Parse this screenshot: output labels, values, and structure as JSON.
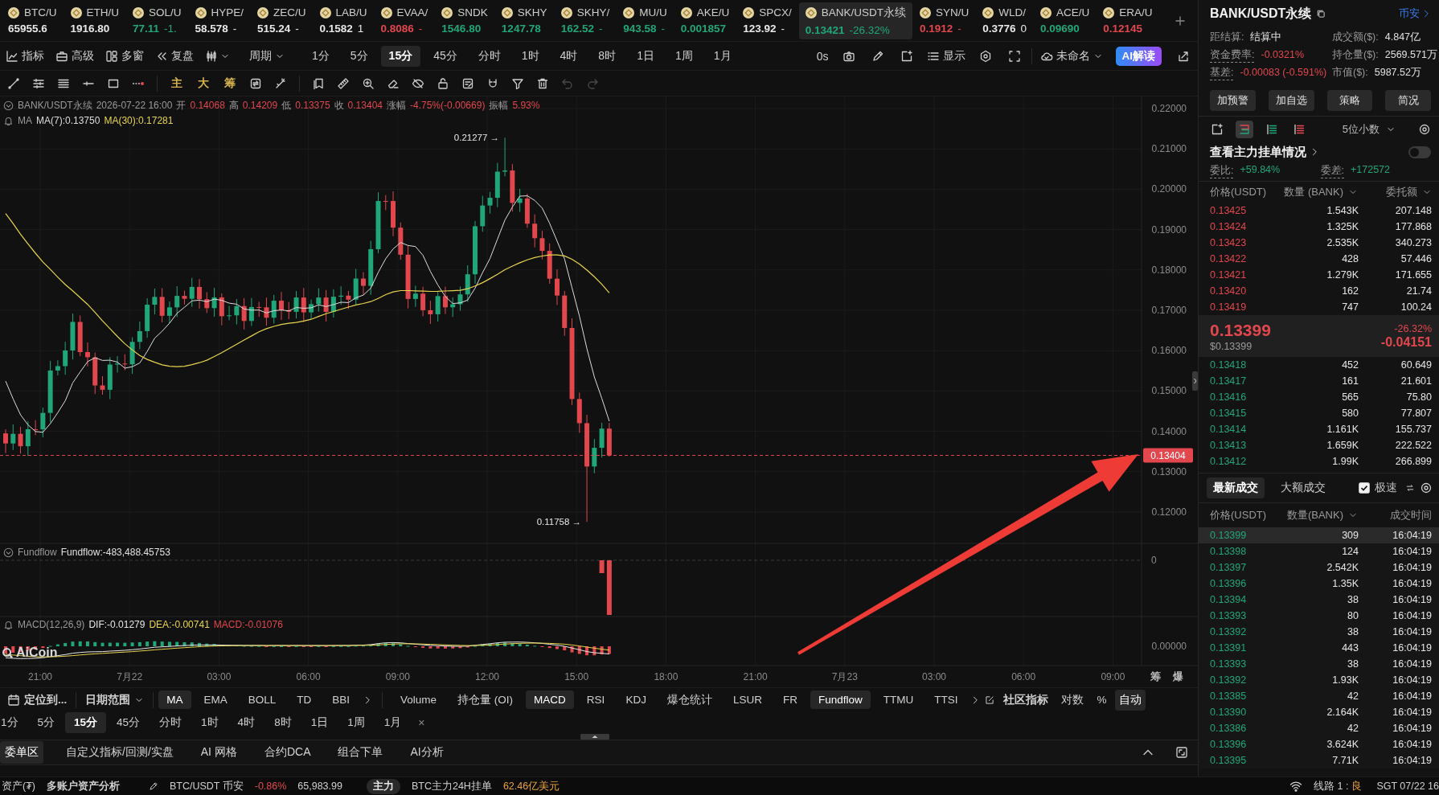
{
  "ticker": {
    "items": [
      {
        "symbol": "BTC/U",
        "price": "65955.6",
        "color": "#e8e8e8",
        "selected": false
      },
      {
        "symbol": "ETH/U",
        "price": "1916.80",
        "color": "#e8e8e8",
        "selected": false
      },
      {
        "symbol": "SOL/U",
        "price": "77.11",
        "change": "-1.",
        "color": "#21a67a",
        "selected": false
      },
      {
        "symbol": "HYPE/",
        "price": "58.578",
        "change": "-",
        "color": "#e8e8e8",
        "selected": false
      },
      {
        "symbol": "ZEC/U",
        "price": "515.24",
        "change": "-",
        "color": "#e8e8e8",
        "selected": false
      },
      {
        "symbol": "LAB/U",
        "price": "0.1582",
        "change": "1",
        "color": "#e8e8e8",
        "selected": false
      },
      {
        "symbol": "EVAA/",
        "price": "0.8086",
        "change": "-",
        "color": "#e2474e",
        "selected": false
      },
      {
        "symbol": "SNDK",
        "price": "1546.80",
        "color": "#21a67a",
        "selected": false
      },
      {
        "symbol": "SKHY",
        "price": "1247.78",
        "color": "#21a67a",
        "selected": false
      },
      {
        "symbol": "SKHY/",
        "price": "162.52",
        "change": "-",
        "color": "#21a67a",
        "selected": false
      },
      {
        "symbol": "MU/U",
        "price": "943.58",
        "change": "-",
        "color": "#21a67a",
        "selected": false
      },
      {
        "symbol": "AKE/U",
        "price": "0.001857",
        "color": "#21a67a",
        "selected": false
      },
      {
        "symbol": "SPCX/",
        "price": "123.92",
        "change": "-",
        "color": "#e8e8e8",
        "selected": false
      },
      {
        "symbol": "BANK/USDT永续",
        "price": "0.13421",
        "change": "-26.32%",
        "color": "#21a67a",
        "selected": true
      },
      {
        "symbol": "SYN/U",
        "price": "0.1912",
        "change": "-",
        "color": "#e2474e",
        "selected": false
      },
      {
        "symbol": "WLD/",
        "price": "0.3776",
        "change": "0",
        "color": "#e8e8e8",
        "selected": false
      },
      {
        "symbol": "ACE/U",
        "price": "0.09690",
        "color": "#21a67a",
        "selected": false
      },
      {
        "symbol": "ERA/U",
        "price": "0.12145",
        "color": "#e2474e",
        "selected": false
      }
    ]
  },
  "toolbar": {
    "tools": [
      {
        "kind": "indicators",
        "label": "指标"
      },
      {
        "kind": "advanced",
        "label": "高级"
      },
      {
        "kind": "multi_window",
        "label": "多窗"
      },
      {
        "kind": "replay",
        "label": "复盘"
      }
    ],
    "period_menu": "周期",
    "periods": [
      {
        "label": "1分",
        "selected": false
      },
      {
        "label": "5分",
        "selected": false
      },
      {
        "label": "15分",
        "selected": true
      },
      {
        "label": "45分",
        "selected": false
      },
      {
        "label": "分时",
        "selected": false
      },
      {
        "label": "1时",
        "selected": false
      },
      {
        "label": "4时",
        "selected": false
      },
      {
        "label": "8时",
        "selected": false
      },
      {
        "label": "1日",
        "selected": false
      },
      {
        "label": "1周",
        "selected": false
      },
      {
        "label": "1月",
        "selected": false
      }
    ],
    "refresh": "0s",
    "display": "显示",
    "layout_name": "未命名",
    "ai_button": "AI解读"
  },
  "drawing_tools": {
    "chips": [
      "主",
      "大",
      "筹"
    ]
  },
  "chart": {
    "legend": {
      "symbol": "BANK/USDT永续",
      "time": "2026-07-22 16:00",
      "color": "#e2474e",
      "fields": [
        {
          "label": "开",
          "value": "0.14068"
        },
        {
          "label": "高",
          "value": "0.14209"
        },
        {
          "label": "低",
          "value": "0.13375"
        },
        {
          "label": "收",
          "value": "0.13404"
        },
        {
          "label": "涨幅",
          "value": "-4.75%(-0.00669)"
        },
        {
          "label": "振幅",
          "value": "5.93%"
        }
      ]
    },
    "ma_legend": {
      "name": "MA",
      "lines": [
        {
          "label": "MA(7):0.13750",
          "color": "#dddddd"
        },
        {
          "label": "MA(30):0.17281",
          "color": "#e8d44d"
        }
      ]
    },
    "price_axis": [
      "0.22000",
      "0.21000",
      "0.20000",
      "0.19000",
      "0.18000",
      "0.17000",
      "0.16000",
      "0.15000",
      "0.14000",
      "0.13000",
      "0.12000"
    ],
    "last_price_tag": "0.13404",
    "high_marker": "0.21277 →",
    "low_marker": "0.11758 →",
    "watermark": "AiCoin",
    "fundflow": {
      "name": "Fundflow",
      "value": "Fundflow:-483,488.45753",
      "axis": "0"
    },
    "macd": {
      "name": "MACD(12,26,9)",
      "fields": [
        {
          "text": "DIF:-0.01279",
          "color": "#e6e6e6"
        },
        {
          "text": "DEA:-0.00741",
          "color": "#e8d44d"
        },
        {
          "text": "MACD:-0.01076",
          "color": "#e2474e"
        }
      ],
      "axis": "0.00000"
    },
    "time_axis": [
      "21:00",
      "7月22",
      "03:00",
      "06:00",
      "09:00",
      "12:00",
      "15:00",
      "18:00",
      "21:00",
      "7月23",
      "03:00",
      "06:00",
      "09:00"
    ],
    "corner_labels": [
      "筹",
      "爆"
    ]
  },
  "indicator_bar": {
    "locate": "定位到...",
    "date_range": "日期范围",
    "main_indicators": [
      {
        "label": "MA",
        "selected": true
      },
      {
        "label": "EMA",
        "selected": false
      },
      {
        "label": "BOLL",
        "selected": false
      },
      {
        "label": "TD",
        "selected": false
      },
      {
        "label": "BBI",
        "selected": false
      }
    ],
    "sub_indicators": [
      {
        "label": "Volume",
        "selected": false
      },
      {
        "label": "持仓量 (OI)",
        "selected": false
      },
      {
        "label": "MACD",
        "selected": true
      },
      {
        "label": "RSI",
        "selected": false
      },
      {
        "label": "KDJ",
        "selected": false
      },
      {
        "label": "爆仓统计",
        "selected": false
      },
      {
        "label": "LSUR",
        "selected": false
      },
      {
        "label": "FR",
        "selected": false
      },
      {
        "label": "Fundflow",
        "selected": true
      },
      {
        "label": "TTMU",
        "selected": false
      },
      {
        "label": "TTSI",
        "selected": false
      }
    ],
    "community": "社区指标",
    "scales": [
      {
        "label": "对数",
        "selected": false
      },
      {
        "label": "%",
        "selected": false
      },
      {
        "label": "自动",
        "selected": true
      }
    ]
  },
  "period_row": {
    "periods": [
      {
        "label": "1分",
        "selected": false
      },
      {
        "label": "5分",
        "selected": false
      },
      {
        "label": "15分",
        "selected": true
      },
      {
        "label": "45分",
        "selected": false
      },
      {
        "label": "分时",
        "selected": false
      },
      {
        "label": "1时",
        "selected": false
      },
      {
        "label": "4时",
        "selected": false
      },
      {
        "label": "8时",
        "selected": false
      },
      {
        "label": "1日",
        "selected": false
      },
      {
        "label": "1周",
        "selected": false
      },
      {
        "label": "1月",
        "selected": false
      }
    ],
    "close": "×"
  },
  "bottom_tabs": [
    {
      "label": "委单区",
      "selected": true
    },
    {
      "label": "自定义指标/回测/实盘",
      "selected": false
    },
    {
      "label": "AI 网格",
      "selected": false
    },
    {
      "label": "合约DCA",
      "selected": false
    },
    {
      "label": "组合下单",
      "selected": false
    },
    {
      "label": "AI分析",
      "selected": false
    }
  ],
  "status_bar": {
    "assets": "资产(₮)",
    "multi_account": "多账户资产分析",
    "pair": {
      "name": "BTC/USDT 币安",
      "change": "-0.86%",
      "color": "#e2474e",
      "price": "65,983.99"
    },
    "badge": "主力",
    "info_label": "BTC主力24H挂单",
    "info_value": "62.46亿美元",
    "line": {
      "label": "线路 1 :",
      "quality": "良"
    },
    "clock": "SGT 07/22 16"
  },
  "market": {
    "title": "BANK/USDT永续",
    "exchange": "币安",
    "stats": [
      {
        "label": "距结算:",
        "value": "结算中",
        "dotted_underline": false
      },
      {
        "label": "成交额($):",
        "value": "4.847亿",
        "dotted_underline": false
      },
      {
        "label": "资金费率:",
        "value": "-0.0321%",
        "color": "#e2474e",
        "dotted_underline": true
      },
      {
        "label": "持仓量($):",
        "value": "2569.571万",
        "dotted_underline": false
      },
      {
        "label": "基差:",
        "value": "-0.00083 (-0.591%)",
        "color": "#e2474e",
        "dotted_underline": true
      },
      {
        "label": "市值($):",
        "value": "5987.52万",
        "dotted_underline": false
      }
    ],
    "actions": [
      "加预警",
      "加自选",
      "策略",
      "简况"
    ]
  },
  "order_book": {
    "view_modes": [
      {
        "kind": "popout",
        "selected": false
      },
      {
        "kind": "split",
        "selected": true
      },
      {
        "kind": "bids",
        "selected": false
      },
      {
        "kind": "asks",
        "selected": false
      }
    ],
    "precision": "5位小数",
    "whale_orders": {
      "label": "查看主力挂单情况",
      "on": false
    },
    "ratio": {
      "label": "委比:",
      "value": "+59.84%",
      "color": "#21a67a"
    },
    "difference": {
      "label": "委差:",
      "value": "+172572",
      "color": "#21a67a"
    },
    "columns": [
      {
        "label": "价格(USDT)",
        "sortable": false
      },
      {
        "label": "数量 (BANK)",
        "sortable": true
      },
      {
        "label": "委托额",
        "sortable": true
      }
    ],
    "asks": [
      {
        "price": "0.13425",
        "amount": "1.543K",
        "total": "207.148"
      },
      {
        "price": "0.13424",
        "amount": "1.325K",
        "total": "177.868"
      },
      {
        "price": "0.13423",
        "amount": "2.535K",
        "total": "340.273"
      },
      {
        "price": "0.13422",
        "amount": "428",
        "total": "57.446"
      },
      {
        "price": "0.13421",
        "amount": "1.279K",
        "total": "171.655"
      },
      {
        "price": "0.13420",
        "amount": "162",
        "total": "21.74"
      },
      {
        "price": "0.13419",
        "amount": "747",
        "total": "100.24"
      }
    ],
    "last": {
      "price": "0.13399",
      "usd": "$0.13399",
      "change_pct": "-26.32%",
      "change": "-0.04151",
      "color": "#e2474e"
    },
    "bids": [
      {
        "price": "0.13418",
        "amount": "452",
        "total": "60.649"
      },
      {
        "price": "0.13417",
        "amount": "161",
        "total": "21.601"
      },
      {
        "price": "0.13416",
        "amount": "565",
        "total": "75.80"
      },
      {
        "price": "0.13415",
        "amount": "580",
        "total": "77.807"
      },
      {
        "price": "0.13414",
        "amount": "1.161K",
        "total": "155.737"
      },
      {
        "price": "0.13413",
        "amount": "1.659K",
        "total": "222.522"
      },
      {
        "price": "0.13412",
        "amount": "1.99K",
        "total": "266.899"
      }
    ]
  },
  "trades": {
    "tabs": [
      {
        "label": "最新成交",
        "selected": true
      },
      {
        "label": "大额成交",
        "selected": false
      }
    ],
    "fast_mode": {
      "label": "极速",
      "checked": true
    },
    "columns": [
      {
        "label": "价格(USDT)",
        "sortable": false
      },
      {
        "label": "数量(BANK)",
        "sortable": true
      },
      {
        "label": "成交时间",
        "sortable": false
      }
    ],
    "rows": [
      {
        "price": "0.13399",
        "amount": "309",
        "time": "16:04:19",
        "kind": "buy",
        "highlighted": true
      },
      {
        "price": "0.13398",
        "amount": "124",
        "time": "16:04:19",
        "kind": "buy",
        "highlighted": false
      },
      {
        "price": "0.13397",
        "amount": "2.542K",
        "time": "16:04:19",
        "kind": "buy",
        "highlighted": false
      },
      {
        "price": "0.13396",
        "amount": "1.35K",
        "time": "16:04:19",
        "kind": "buy",
        "highlighted": false
      },
      {
        "price": "0.13394",
        "amount": "38",
        "time": "16:04:19",
        "kind": "buy",
        "highlighted": false
      },
      {
        "price": "0.13393",
        "amount": "80",
        "time": "16:04:19",
        "kind": "buy",
        "highlighted": false
      },
      {
        "price": "0.13392",
        "amount": "38",
        "time": "16:04:19",
        "kind": "buy",
        "highlighted": false
      },
      {
        "price": "0.13391",
        "amount": "443",
        "time": "16:04:19",
        "kind": "buy",
        "highlighted": false
      },
      {
        "price": "0.13393",
        "amount": "38",
        "time": "16:04:19",
        "kind": "buy",
        "highlighted": false
      },
      {
        "price": "0.13392",
        "amount": "1.93K",
        "time": "16:04:19",
        "kind": "buy",
        "highlighted": false
      },
      {
        "price": "0.13385",
        "amount": "42",
        "time": "16:04:19",
        "kind": "buy",
        "highlighted": false
      },
      {
        "price": "0.13390",
        "amount": "2.164K",
        "time": "16:04:19",
        "kind": "buy",
        "highlighted": false
      },
      {
        "price": "0.13386",
        "amount": "42",
        "time": "16:04:19",
        "kind": "buy",
        "highlighted": false
      },
      {
        "price": "0.13396",
        "amount": "3.624K",
        "time": "16:04:19",
        "kind": "buy",
        "highlighted": false
      },
      {
        "price": "0.13395",
        "amount": "7.71K",
        "time": "16:04:19",
        "kind": "buy",
        "highlighted": false
      }
    ]
  }
}
